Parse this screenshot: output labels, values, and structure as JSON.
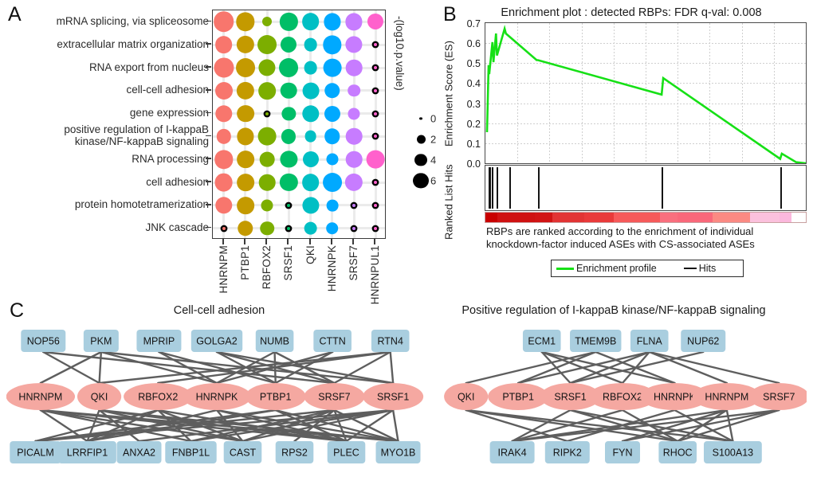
{
  "panels": {
    "a_letter": "A",
    "b_letter": "B",
    "c_letter": "C"
  },
  "chart_data": [
    {
      "type": "heatmap",
      "name": "go-term-rbp-dotplot",
      "title": "",
      "xlabel": "",
      "ylabel": "",
      "legend_title": "-(log10.p.value)",
      "legend_values": [
        0,
        2,
        4,
        6
      ],
      "grid": true,
      "categories_x": [
        "HNRNPM",
        "PTBP1",
        "RBFOX2",
        "SRSF1",
        "QKI",
        "HNRNPK",
        "SRSF7",
        "HNRNPUL1"
      ],
      "column_colors": [
        "#F8766D",
        "#C49A00",
        "#7CAE00",
        "#00BE67",
        "#00BFC4",
        "#00A9FF",
        "#C77CFF",
        "#FF61CC"
      ],
      "categories_y": [
        "mRNA splicing, via spliceosome",
        "extracellular matrix organization",
        "RNA export from nucleus",
        "cell-cell adhesion",
        "gene expression",
        "positive regulation of I-kappaB\nkinase/NF-kappaB signaling",
        "RNA processing",
        "cell adhesion",
        "protein homotetramerization",
        "JNK cascade"
      ],
      "values": [
        [
          6.2,
          5.4,
          1.3,
          5.0,
          4.8,
          4.6,
          4.6,
          4.2
        ],
        [
          4.8,
          5.0,
          5.6,
          4.2,
          3.0,
          5.4,
          4.6,
          0.4
        ],
        [
          6.0,
          5.6,
          4.6,
          5.6,
          3.0,
          5.2,
          4.4,
          0.5
        ],
        [
          4.9,
          5.0,
          4.8,
          4.4,
          4.5,
          4.0,
          2.6,
          0.5
        ],
        [
          4.7,
          4.8,
          0.3,
          3.2,
          4.7,
          4.2,
          2.4,
          0.4
        ],
        [
          3.6,
          4.6,
          5.2,
          3.5,
          2.3,
          4.0,
          4.4,
          0.5
        ],
        [
          5.4,
          4.8,
          3.7,
          4.6,
          4.2,
          2.4,
          4.4,
          5.2
        ],
        [
          5.2,
          4.8,
          4.4,
          5.0,
          4.8,
          5.6,
          5.0,
          0.6
        ],
        [
          4.7,
          4.8,
          2.4,
          0.4,
          4.6,
          2.3,
          0.4,
          0.4
        ],
        [
          0.4,
          4.0,
          3.3,
          0.4,
          3.0,
          2.6,
          0.4,
          0.4
        ]
      ]
    },
    {
      "type": "line",
      "name": "gsea-enrichment-plot",
      "title": "Enrichment plot : detected RBPs: FDR q-val: 0.008",
      "ylabel": "Enrichment Score (ES)",
      "xlabel": "",
      "hits_ylabel": "Ranked List Hits",
      "ylim": [
        0.0,
        0.7
      ],
      "yticks": [
        "0.7",
        "0.6",
        "0.5",
        "0.4",
        "0.3",
        "0.2",
        "0.1",
        "0.0"
      ],
      "grid": true,
      "line_color": "#16e016",
      "caption": "RBPs are ranked according to the enrichment of individual knockdown-factor induced ASEs with CS-associated ASEs",
      "legend": [
        {
          "label": "Enrichment profile",
          "marker": "green-line"
        },
        {
          "label": "Hits",
          "marker": "black-line"
        }
      ],
      "x": [
        0.5,
        1.0,
        1.2,
        2.2,
        2.5,
        3.3,
        3.6,
        6.0,
        6.4,
        16.0,
        16.4,
        55.0,
        55.5,
        92.0,
        92.5,
        97.0,
        100.0
      ],
      "y": [
        0.155,
        0.49,
        0.445,
        0.605,
        0.505,
        0.648,
        0.538,
        0.672,
        0.648,
        0.515,
        0.515,
        0.343,
        0.425,
        0.022,
        0.048,
        0.005,
        0.0
      ],
      "hits_positions": [
        0.9,
        1.3,
        1.9,
        3.5,
        7.5,
        16.5,
        55.0,
        92.0
      ],
      "gradient_segments": [
        {
          "color": "#c90000",
          "width": 4
        },
        {
          "color": "#cf1111",
          "width": 13
        },
        {
          "color": "#d11414",
          "width": 6
        },
        {
          "color": "#e23434",
          "width": 11
        },
        {
          "color": "#e93a3a",
          "width": 10
        },
        {
          "color": "#f65a5a",
          "width": 16
        },
        {
          "color": "#f96f7e",
          "width": 6
        },
        {
          "color": "#f9687a",
          "width": 12
        },
        {
          "color": "#fb8a83",
          "width": 13
        },
        {
          "color": "#fbc1dd",
          "width": 10
        },
        {
          "color": "#fbb8dd",
          "width": 4
        },
        {
          "color": "#ffffff",
          "width": 5
        }
      ]
    }
  ],
  "networks": [
    {
      "name": "cell-cell-adhesion-network",
      "title": "Cell-cell adhesion",
      "top_nodes": [
        "NOP56",
        "PKM",
        "MPRIP",
        "GOLGA2",
        "NUMB",
        "CTTN",
        "RTN4"
      ],
      "middle_nodes": [
        "HNRNPM",
        "QKI",
        "RBFOX2",
        "HNRNPK",
        "PTBP1",
        "SRSF7",
        "SRSF1"
      ],
      "bottom_nodes": [
        "PICALM",
        "LRRFIP1",
        "ANXA2",
        "FNBP1L",
        "CAST",
        "RPS2",
        "PLEC",
        "MYO1B"
      ],
      "node_rect_color": "#A9CEDF",
      "node_ellipse_color": "#F5A8A1",
      "edge_color": "#5e5e5e"
    },
    {
      "name": "ikappab-nfkappab-signaling-network",
      "title": "Positive regulation of I-kappaB kinase/NF-kappaB signaling",
      "top_nodes": [
        "ECM1",
        "TMEM9B",
        "FLNA",
        "NUP62"
      ],
      "middle_nodes": [
        "QKI",
        "PTBP1",
        "SRSF1",
        "RBFOX2",
        "HNRNPK",
        "HNRNPM",
        "SRSF7"
      ],
      "bottom_nodes": [
        "IRAK4",
        "RIPK2",
        "FYN",
        "RHOC",
        "S100A13"
      ],
      "node_rect_color": "#A9CEDF",
      "node_ellipse_color": "#F5A8A1",
      "edge_color": "#5e5e5e"
    }
  ]
}
